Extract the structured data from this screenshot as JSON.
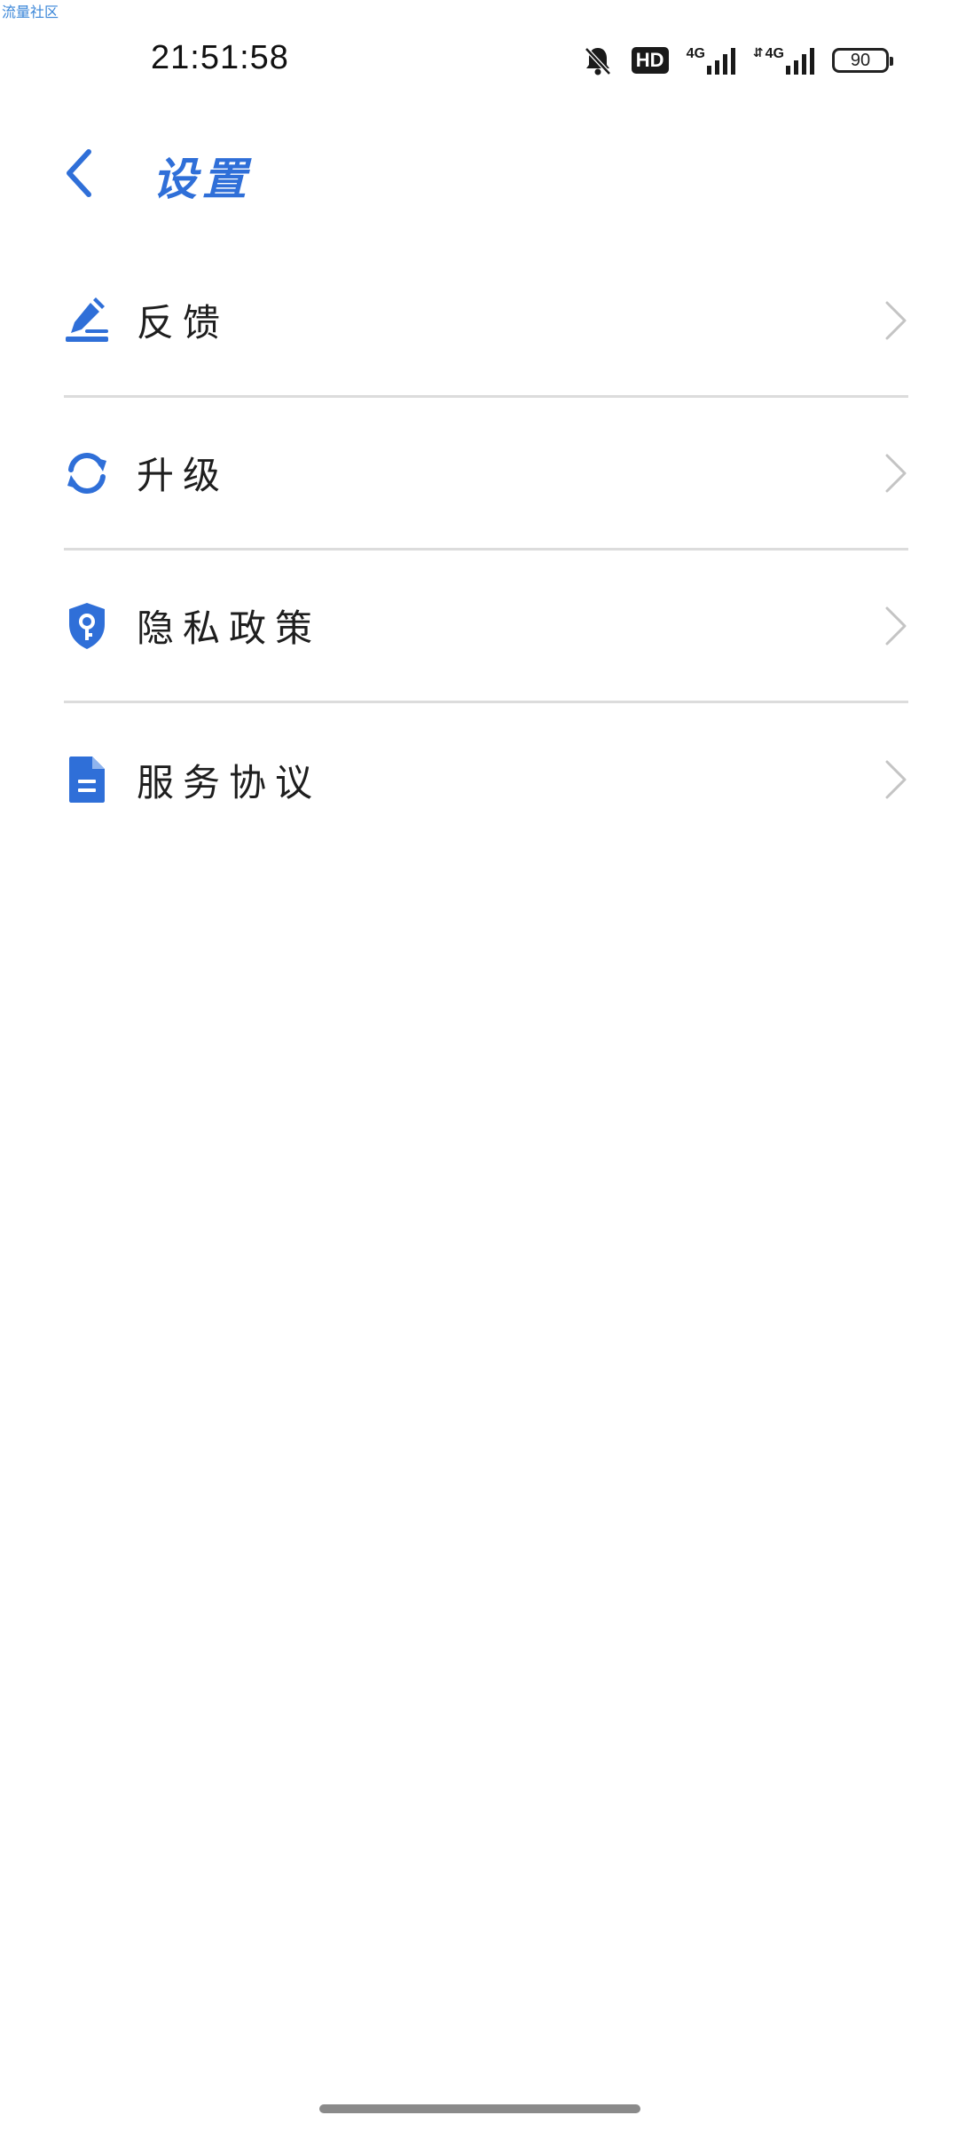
{
  "watermark": "流量社区",
  "status_bar": {
    "time": "21:51:58",
    "hd_label": "HD",
    "network_1": "4G",
    "network_2": "4G",
    "battery": "90"
  },
  "header": {
    "back_icon": "chevron-left-icon",
    "title": "设置"
  },
  "colors": {
    "accent": "#2f6fd8",
    "divider": "#dcdcdc",
    "chevron": "#c4c4c4"
  },
  "items": [
    {
      "label": "反馈",
      "icon": "feedback-edit-icon"
    },
    {
      "label": "升级",
      "icon": "refresh-icon"
    },
    {
      "label": "隐私政策",
      "icon": "shield-key-icon"
    },
    {
      "label": "服务协议",
      "icon": "document-icon"
    }
  ]
}
